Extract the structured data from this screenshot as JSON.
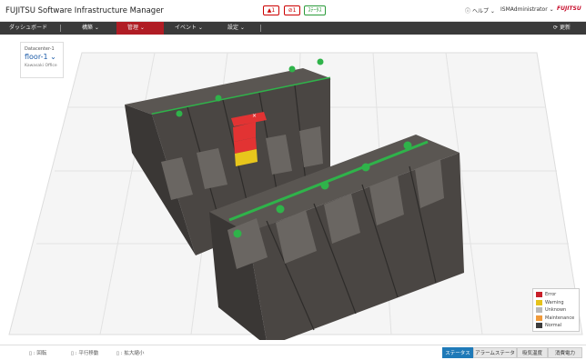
{
  "app": {
    "title": "FUJITSU Software Infrastructure Manager"
  },
  "status_chips": {
    "error": "1",
    "warning": "1",
    "ok": "ｽﾃｰﾀｽ"
  },
  "header": {
    "help": "ヘルプ",
    "user": "ISMAdministrator",
    "logo": "FUJITSU"
  },
  "nav": {
    "items": [
      "ダッシュボード",
      "構築",
      "管理",
      "イベント",
      "設定"
    ],
    "active_index": 2,
    "refresh": "更新"
  },
  "floor": {
    "label": "Datacenter-1",
    "name": "floor-1",
    "sub": "Kawasaki Office"
  },
  "legend": [
    {
      "label": "Error",
      "color": "#c8202a"
    },
    {
      "label": "Warning",
      "color": "#e6c21a"
    },
    {
      "label": "Unknown",
      "color": "#b8b8b8"
    },
    {
      "label": "Maintenance",
      "color": "#f09a3a"
    },
    {
      "label": "Normal",
      "color": "#3d3d3d"
    }
  ],
  "bottom": {
    "hints": [
      ": 回転",
      ": 平行移動",
      ": 拡大縮小"
    ],
    "tabs": [
      "ステータス",
      "アラームステータス",
      "吸気温度",
      "消費電力"
    ],
    "active_tab": 0
  },
  "colors": {
    "rack_top": "#5a5652",
    "rack_front": "#4a4643",
    "rack_side": "#3a3735",
    "status_ok": "#2fb34a",
    "error": "#e23333",
    "warning": "#e8c61c"
  }
}
